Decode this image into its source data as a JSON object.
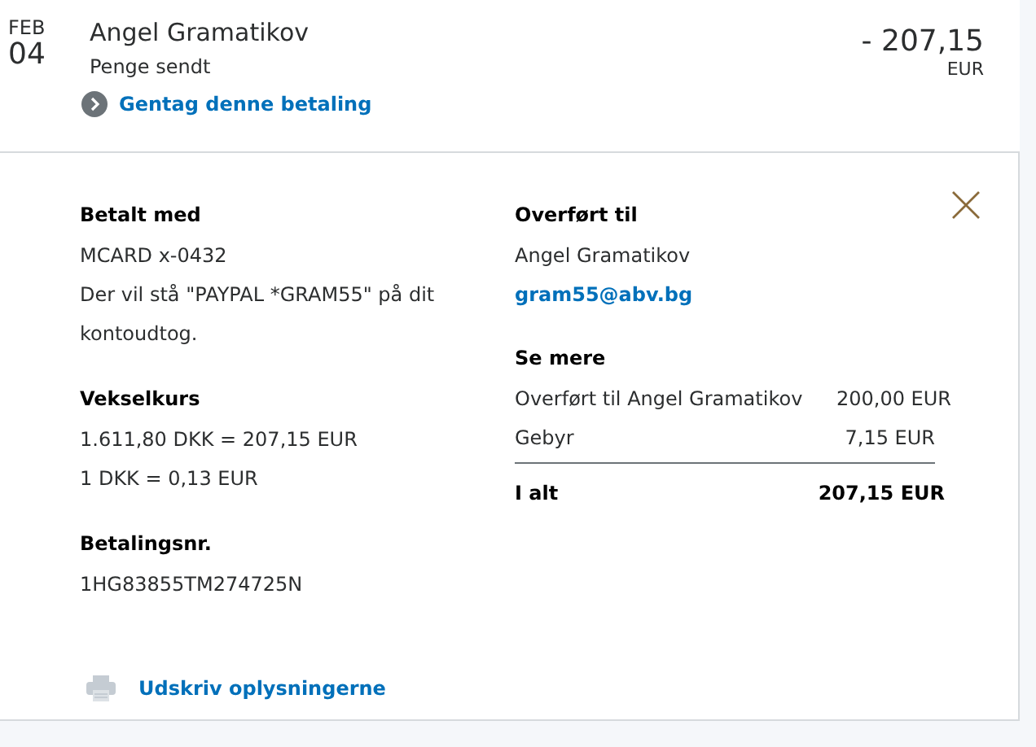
{
  "transaction": {
    "month": "FEB",
    "day": "04",
    "name": "Angel Gramatikov",
    "status": "Penge sendt",
    "amount": "- 207,15",
    "currency": "EUR",
    "repeat_link": "Gentag denne betaling"
  },
  "details": {
    "left": [
      {
        "heading": "Betalt med",
        "lines": [
          "MCARD x-0432",
          "Der vil stå \"PAYPAL *GRAM55\" på dit kontoudtog."
        ]
      },
      {
        "heading": "Vekselkurs",
        "lines": [
          "1.611,80 DKK = 207,15 EUR",
          "1 DKK = 0,13 EUR"
        ]
      },
      {
        "heading": "Betalingsnr.",
        "lines": [
          "1HG83855TM274725N"
        ]
      }
    ],
    "transferred_to": {
      "heading": "Overført til",
      "name": "Angel Gramatikov",
      "email": "gram55@abv.bg"
    },
    "see_more": {
      "heading": "Se mere",
      "rows": [
        {
          "label": "Overført til Angel Gramatikov",
          "value": "200,00 EUR"
        },
        {
          "label": "Gebyr",
          "value": "7,15 EUR"
        }
      ],
      "total": {
        "label": "I alt",
        "value": "207,15 EUR"
      }
    },
    "print_link": "Udskriv oplysningerne"
  }
}
